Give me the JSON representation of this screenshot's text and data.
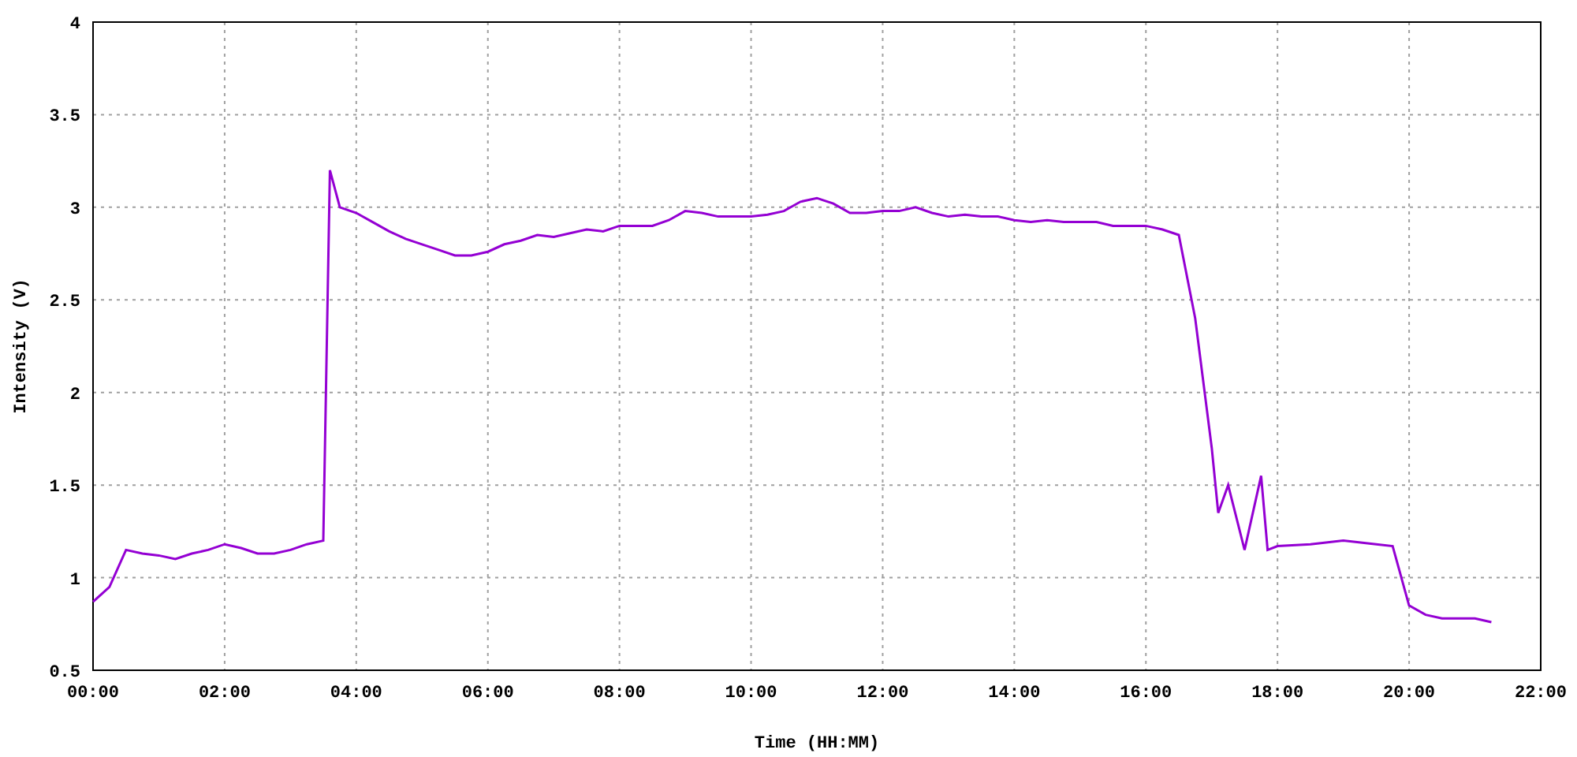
{
  "chart": {
    "chart_data": {
      "type": "line",
      "xlabel": "Time (HH:MM)",
      "ylabel": "Intensity (V)",
      "x": [
        0,
        0.25,
        0.5,
        0.75,
        1,
        1.25,
        1.5,
        1.75,
        2,
        2.25,
        2.5,
        2.75,
        3,
        3.25,
        3.5,
        3.6,
        3.75,
        4,
        4.25,
        4.5,
        4.75,
        5,
        5.25,
        5.5,
        5.75,
        6,
        6.25,
        6.5,
        6.75,
        7,
        7.25,
        7.5,
        7.75,
        8,
        8.25,
        8.5,
        8.75,
        9,
        9.25,
        9.5,
        9.75,
        10,
        10.25,
        10.5,
        10.75,
        11,
        11.25,
        11.5,
        11.75,
        12,
        12.25,
        12.5,
        12.75,
        13,
        13.25,
        13.5,
        13.75,
        14,
        14.25,
        14.5,
        14.75,
        15,
        15.25,
        15.5,
        15.75,
        16,
        16.25,
        16.5,
        16.75,
        17,
        17.1,
        17.25,
        17.5,
        17.75,
        17.85,
        18,
        18.5,
        19,
        19.5,
        19.75,
        20,
        20.25,
        20.5,
        21,
        21.25
      ],
      "series": [
        {
          "color": "#9400d3",
          "values": [
            0.87,
            0.95,
            1.15,
            1.13,
            1.12,
            1.1,
            1.13,
            1.15,
            1.18,
            1.16,
            1.13,
            1.13,
            1.15,
            1.18,
            1.2,
            3.2,
            3.0,
            2.97,
            2.92,
            2.87,
            2.83,
            2.8,
            2.77,
            2.74,
            2.74,
            2.76,
            2.8,
            2.82,
            2.85,
            2.84,
            2.86,
            2.88,
            2.87,
            2.9,
            2.9,
            2.9,
            2.93,
            2.98,
            2.97,
            2.95,
            2.95,
            2.95,
            2.96,
            2.98,
            3.03,
            3.05,
            3.02,
            2.97,
            2.97,
            2.98,
            2.98,
            3.0,
            2.97,
            2.95,
            2.96,
            2.95,
            2.95,
            2.93,
            2.92,
            2.93,
            2.92,
            2.92,
            2.92,
            2.9,
            2.9,
            2.9,
            2.88,
            2.85,
            2.4,
            1.7,
            1.35,
            1.5,
            1.15,
            1.55,
            1.15,
            1.17,
            1.18,
            1.2,
            1.18,
            1.17,
            0.85,
            0.8,
            0.78,
            0.78,
            0.76
          ]
        }
      ],
      "grid": true,
      "xlim": [
        0,
        22
      ],
      "ylim": [
        0.5,
        4
      ],
      "xticks": [
        {
          "value": 0,
          "label": "00:00"
        },
        {
          "value": 2,
          "label": "02:00"
        },
        {
          "value": 4,
          "label": "04:00"
        },
        {
          "value": 6,
          "label": "06:00"
        },
        {
          "value": 8,
          "label": "08:00"
        },
        {
          "value": 10,
          "label": "10:00"
        },
        {
          "value": 12,
          "label": "12:00"
        },
        {
          "value": 14,
          "label": "14:00"
        },
        {
          "value": 16,
          "label": "16:00"
        },
        {
          "value": 18,
          "label": "18:00"
        },
        {
          "value": 20,
          "label": "20:00"
        },
        {
          "value": 22,
          "label": "22:00"
        }
      ],
      "yticks": [
        {
          "value": 0.5,
          "label": "0.5"
        },
        {
          "value": 1,
          "label": "1"
        },
        {
          "value": 1.5,
          "label": "1.5"
        },
        {
          "value": 2,
          "label": "2"
        },
        {
          "value": 2.5,
          "label": "2.5"
        },
        {
          "value": 3,
          "label": "3"
        },
        {
          "value": 3.5,
          "label": "3.5"
        },
        {
          "value": 4,
          "label": "4"
        }
      ]
    }
  }
}
